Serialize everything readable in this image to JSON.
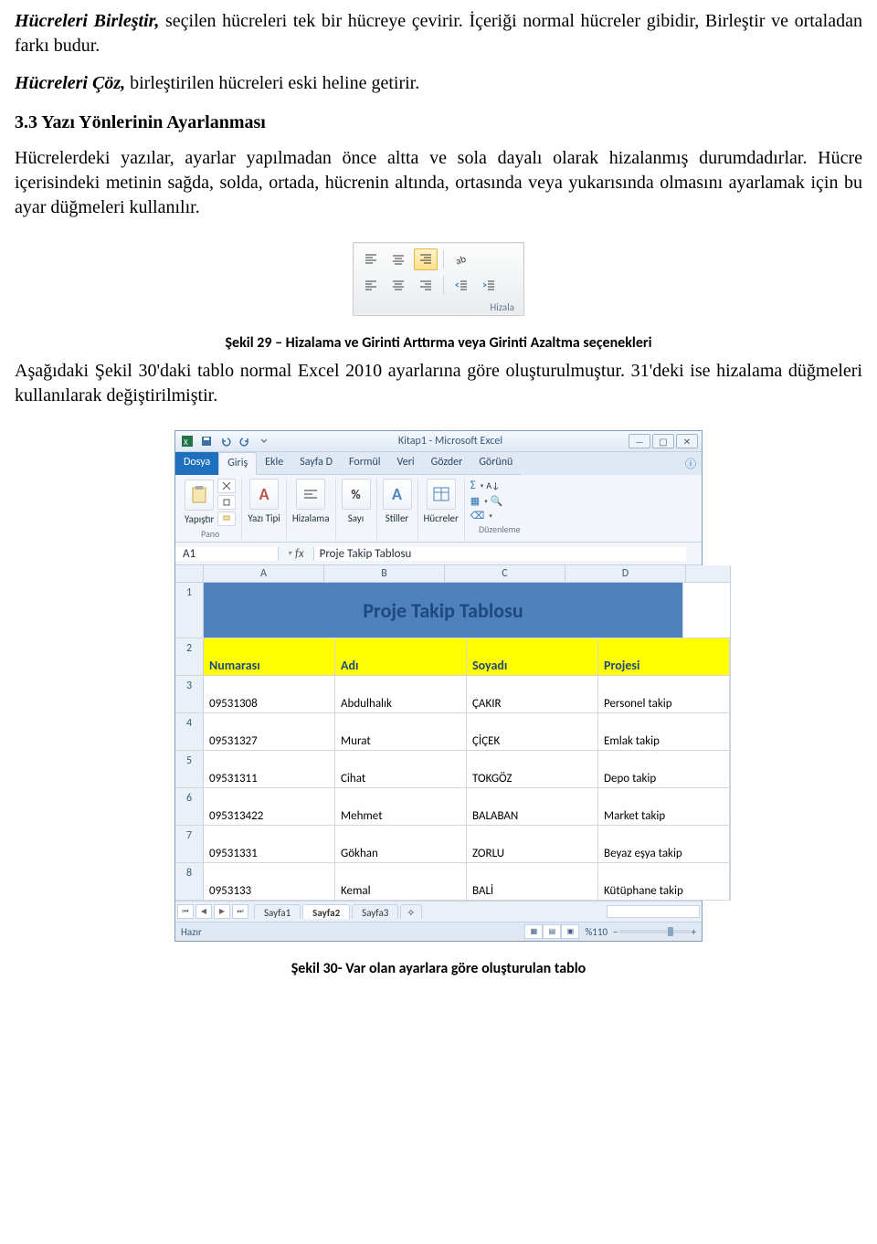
{
  "para1": {
    "bold1": "Hücreleri Birleştir,",
    "rest1": " seçilen hücreleri tek bir hücreye çevirir. İçeriği normal hücreler gibidir, Birleştir ve ortaladan farkı budur."
  },
  "para2": {
    "bold2": "Hücreleri Çöz,",
    "rest2": " birleştirilen hücreleri eski heline getirir."
  },
  "heading33": "3.3 Yazı Yönlerinin Ayarlanması",
  "para3": "Hücrelerdeki yazılar, ayarlar yapılmadan önce altta ve sola dayalı olarak hizalanmış durumdadırlar. Hücre içerisindeki metinin sağda, solda, ortada, hücrenin altında, ortasında veya yukarısında olmasını ayarlamak için bu ayar düğmeleri kullanılır.",
  "fig29": {
    "caption": "Şekil 29 – Hizalama ve Girinti Arttırma veya Girinti Azaltma seçenekleri",
    "panel_label": "Hizala"
  },
  "para4": "Aşağıdaki Şekil 30'daki tablo normal Excel 2010 ayarlarına göre oluşturulmuştur. 31'deki ise hizalama düğmeleri kullanılarak değiştirilmiştir.",
  "fig30": {
    "caption": "Şekil 30- Var olan ayarlara göre oluşturulan tablo"
  },
  "excel": {
    "title": "Kitap1 - Microsoft Excel",
    "tabs": {
      "file": "Dosya",
      "home": "Giriş",
      "insert": "Ekle",
      "layout": "Sayfa D",
      "formulas": "Formül",
      "data": "Veri",
      "review": "Gözder",
      "view": "Görünü"
    },
    "ribbon": {
      "pano": "Pano",
      "paste": "Yapıştır",
      "font": "Yazı Tipi",
      "align": "Hizalama",
      "number": "Sayı",
      "styles": "Stiller",
      "cells": "Hücreler",
      "editing": "Düzenleme",
      "font_icon": "A",
      "percent": "%",
      "styles_icon": "A"
    },
    "namebox": {
      "cell": "A1",
      "fx": "fx",
      "value": "Proje Takip Tablosu"
    },
    "cols": [
      "A",
      "B",
      "C",
      "D"
    ],
    "table": {
      "title": "Proje Takip Tablosu",
      "headers": [
        "Numarası",
        "Adı",
        "Soyadı",
        "Projesi"
      ],
      "rows": [
        {
          "n": "3",
          "cells": [
            "09531308",
            "Abdulhalık",
            "ÇAKIR",
            "Personel takip"
          ]
        },
        {
          "n": "4",
          "cells": [
            "09531327",
            "Murat",
            "ÇİÇEK",
            "Emlak takip"
          ]
        },
        {
          "n": "5",
          "cells": [
            "09531311",
            "Cihat",
            "TOKGÖZ",
            "Depo takip"
          ]
        },
        {
          "n": "6",
          "cells": [
            "095313422",
            "Mehmet",
            "BALABAN",
            "Market takip"
          ]
        },
        {
          "n": "7",
          "cells": [
            "09531331",
            "Gökhan",
            "ZORLU",
            "Beyaz eşya takip"
          ]
        },
        {
          "n": "8",
          "cells": [
            "0953133",
            "Kemal",
            "BALİ",
            "Kütüphane takip"
          ]
        }
      ],
      "row1": "1",
      "row2": "2"
    },
    "sheets": {
      "s1": "Sayfa1",
      "s2": "Sayfa2",
      "s3": "Sayfa3"
    },
    "status": {
      "ready": "Hazır",
      "zoom": "%110"
    }
  }
}
